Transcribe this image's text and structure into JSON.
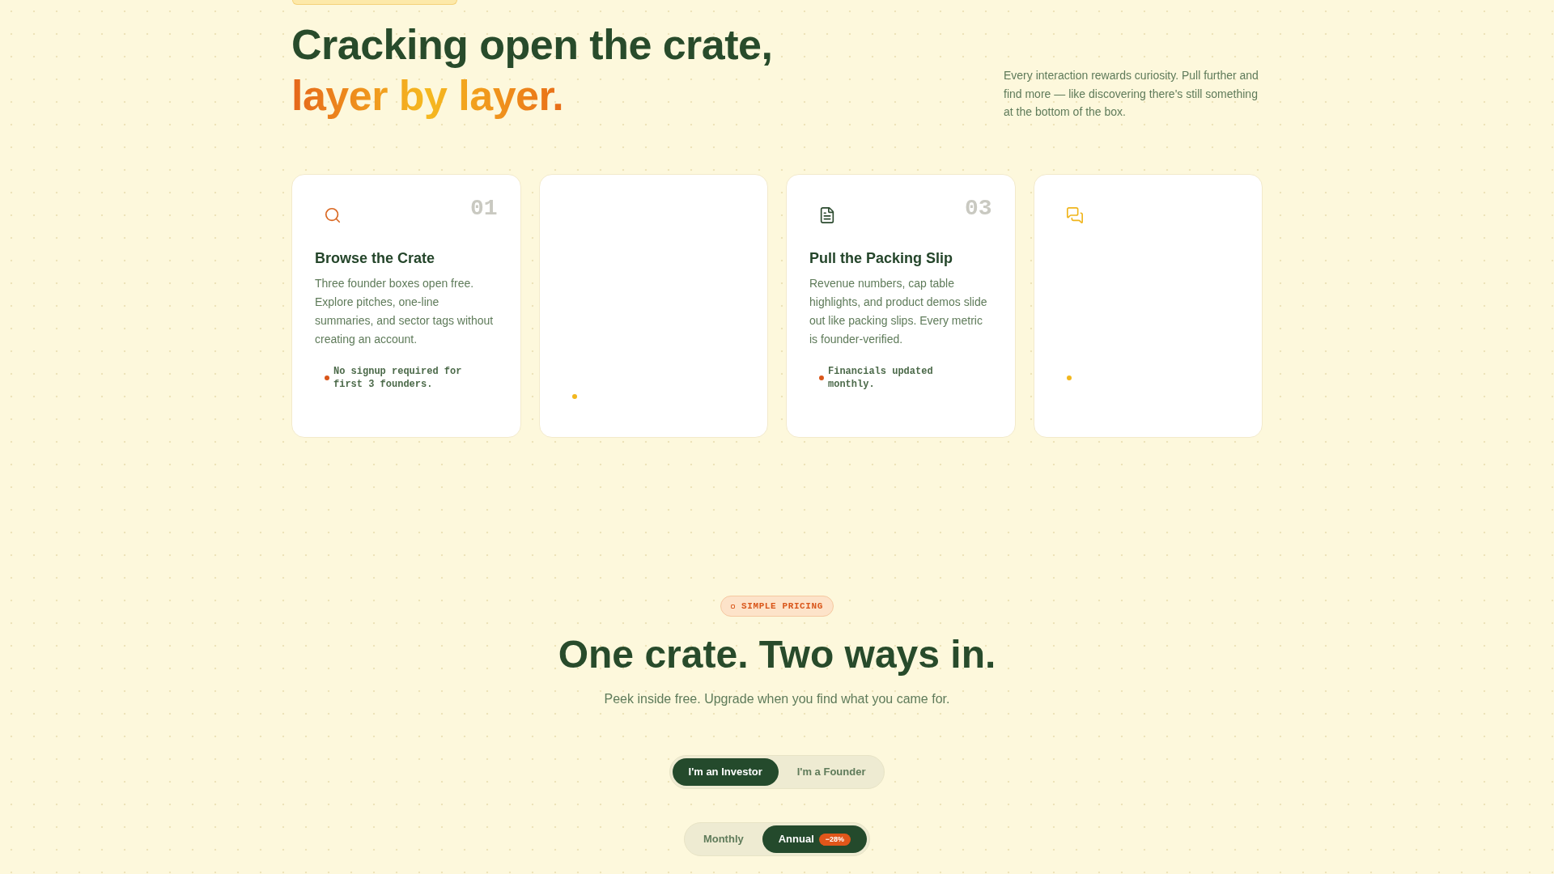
{
  "hero": {
    "title": "Cracking open the crate,",
    "title_highlight": "layer by layer.",
    "description": "Every interaction rewards curiosity. Pull further and find more — like discovering there's still something at the bottom of the box."
  },
  "features": [
    {
      "number": "01",
      "title": "Browse the Crate",
      "description": "Three founder boxes open free. Explore pitches, one-line summaries, and sector tags without creating an account.",
      "note": "No signup required for first 3 founders.",
      "color": "#d9561a"
    },
    {
      "color": "#f2b71e"
    },
    {
      "number": "03",
      "title": "Pull the Packing Slip",
      "description": "Revenue numbers, cap table highlights, and product demos slide out like packing slips. Every metric is founder-verified.",
      "note": "Financials updated monthly.",
      "color": "#d9561a"
    },
    {
      "color": "#f2b71e"
    }
  ],
  "pricing": {
    "tag": "SIMPLE PRICING",
    "title": "One crate. Two ways in.",
    "subtitle": "Peek inside free. Upgrade when you find what you came for.",
    "audience_toggle": [
      {
        "label": "I'm an Investor",
        "selected": true
      },
      {
        "label": "I'm a Founder",
        "selected": false
      }
    ],
    "billing_toggle": [
      {
        "label": "Monthly",
        "selected": false
      },
      {
        "label": "Annual",
        "selected": true,
        "badge": "−28%"
      }
    ]
  }
}
